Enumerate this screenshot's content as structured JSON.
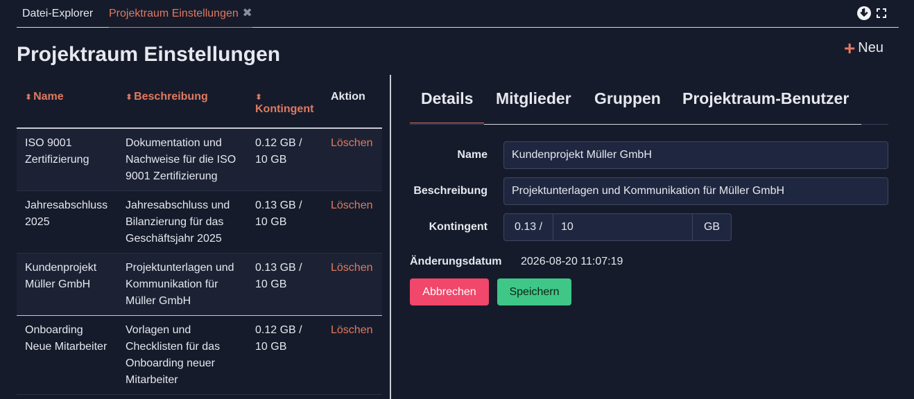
{
  "tabs": [
    {
      "label": "Datei-Explorer"
    },
    {
      "label": "Projektraum Einstellungen",
      "close": "✖"
    }
  ],
  "page": {
    "title": "Projektraum Einstellungen",
    "new_label": "Neu"
  },
  "table": {
    "headers": {
      "name": "Name",
      "description": "Beschreibung",
      "quota": "Kontingent",
      "action": "Aktion"
    },
    "rows": [
      {
        "name": "ISO 9001 Zertifizierung",
        "description": "Dokumentation und Nachweise für die ISO 9001 Zertifizierung",
        "quota": "0.12 GB / 10 GB",
        "action": "Löschen"
      },
      {
        "name": "Jahresabschluss 2025",
        "description": "Jahresabschluss und Bilanzierung für das Geschäftsjahr 2025",
        "quota": "0.13 GB / 10 GB",
        "action": "Löschen"
      },
      {
        "name": "Kundenprojekt Müller GmbH",
        "description": "Projektunterlagen und Kommunikation für Müller GmbH",
        "quota": "0.13 GB / 10 GB",
        "action": "Löschen"
      },
      {
        "name": "Onboarding Neue Mitarbeiter",
        "description": "Vorlagen und Checklisten für das Onboarding neuer Mitarbeiter",
        "quota": "0.12 GB / 10 GB",
        "action": "Löschen"
      }
    ]
  },
  "detail": {
    "tabs": [
      "Details",
      "Mitglieder",
      "Gruppen",
      "Projektraum-Benutzer"
    ],
    "form": {
      "name_label": "Name",
      "name_value": "Kundenprojekt Müller GmbH",
      "desc_label": "Beschreibung",
      "desc_value": "Projektunterlagen und Kommunikation für Müller GmbH",
      "quota_label": "Kontingent",
      "quota_used": "0.13 /",
      "quota_value": "10",
      "quota_unit": "GB",
      "date_label": "Änderungsdatum",
      "date_value": "2026-08-20 11:07:19"
    },
    "buttons": {
      "cancel": "Abbrechen",
      "save": "Speichern"
    }
  },
  "colors": {
    "accent": "#e07a5f",
    "background": "#161b2b",
    "cancel": "#f0476a",
    "save": "#3ec787"
  },
  "icons": {
    "download": "download-circle-icon",
    "fullscreen": "fullscreen-icon",
    "sort": "sort-icon",
    "plus": "plus-icon"
  }
}
